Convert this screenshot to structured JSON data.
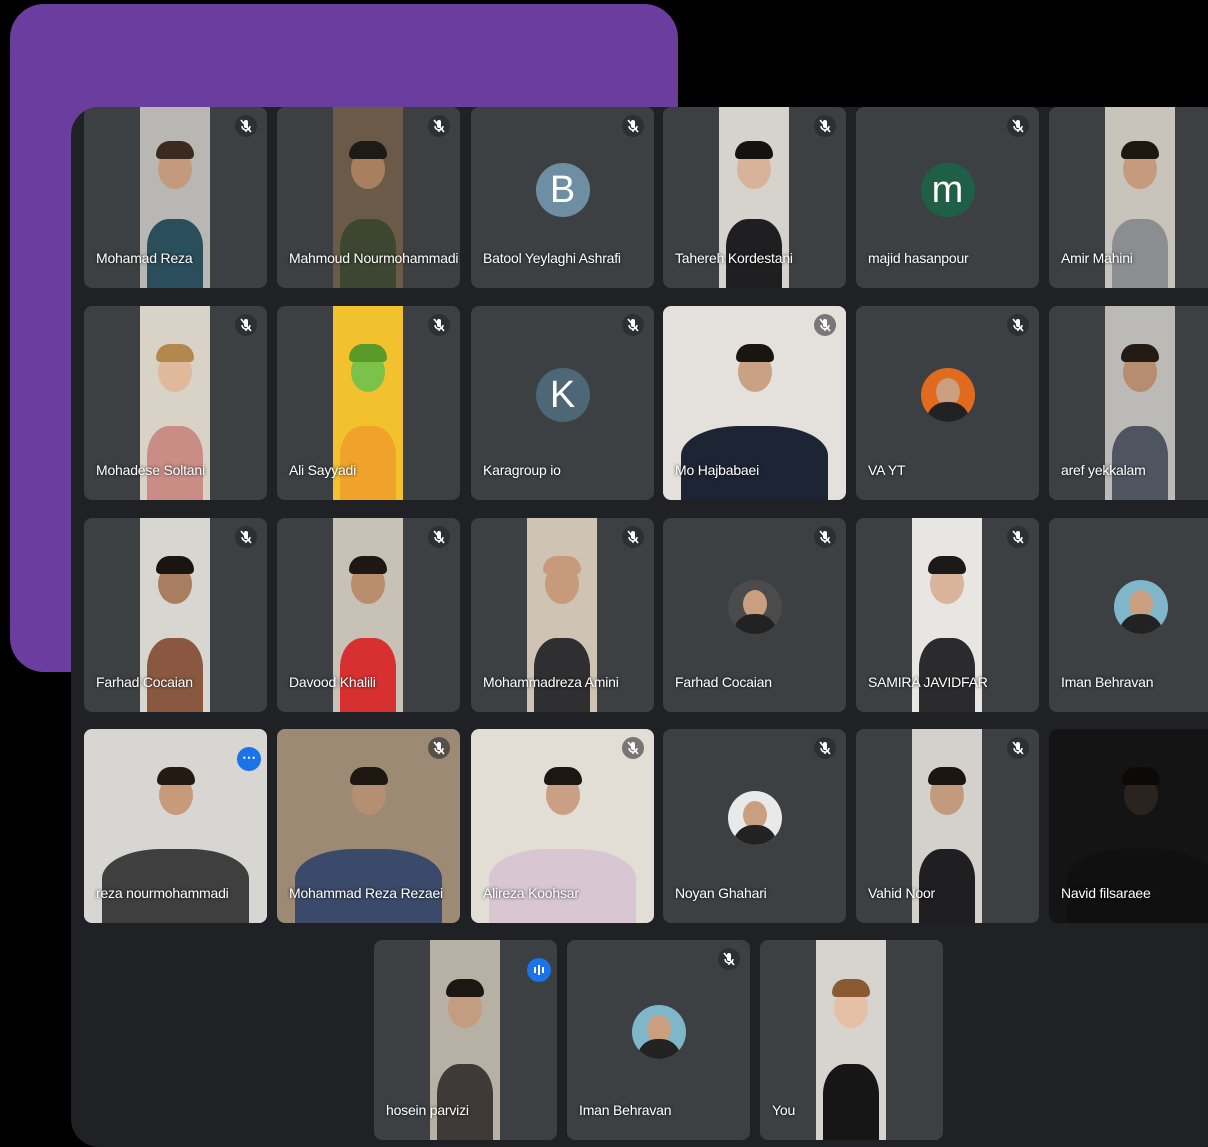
{
  "participants": [
    {
      "name": "Mohamad Reza",
      "kind": "video",
      "bg": "#b9b7b3",
      "skin": "#c49a7c",
      "hair": "#3a2a20",
      "shirt": "#2b4e5c",
      "muted": true
    },
    {
      "name": "Mahmoud Nourmohammadi",
      "kind": "video",
      "bg": "#6b5a47",
      "skin": "#a8805f",
      "hair": "#1e1a16",
      "shirt": "#3d4630",
      "muted": true
    },
    {
      "name": "Batool Yeylaghi Ashrafi",
      "kind": "letter",
      "letter": "B",
      "color": "#6e8ea4",
      "muted": true
    },
    {
      "name": "Tahereh Kordestani",
      "kind": "video",
      "bg": "#d6d2cc",
      "skin": "#d8b39a",
      "hair": "#151210",
      "shirt": "#1f1f22",
      "muted": true
    },
    {
      "name": "majid hasanpour",
      "kind": "letter",
      "letter": "m",
      "color": "#1f5f48",
      "muted": true
    },
    {
      "name": "Amir Mahini",
      "kind": "video",
      "bg": "#c8c3bb",
      "skin": "#c69a7c",
      "hair": "#1d1712",
      "shirt": "#8b8d90",
      "muted": false
    },
    {
      "name": "Mohadese Soltani",
      "kind": "video",
      "bg": "#d9d3c7",
      "skin": "#e0b89c",
      "hair": "#b3884f",
      "shirt": "#c98d86",
      "muted": true
    },
    {
      "name": "Ali Sayyadi",
      "kind": "video",
      "bg": "#f2c12e",
      "skin": "#7cc24a",
      "hair": "#5a9a2a",
      "shirt": "#f0a22a",
      "muted": true
    },
    {
      "name": "Karagroup io",
      "kind": "letter",
      "letter": "K",
      "color": "#4d6777",
      "muted": true
    },
    {
      "name": "Mo Hajbabaei",
      "kind": "video",
      "bg": "#e4e1dc",
      "skin": "#c9a283",
      "hair": "#1b1511",
      "shirt": "#1d2433",
      "muted": true
    },
    {
      "name": "VA YT",
      "kind": "photo",
      "color": "#e06a1e",
      "muted": true
    },
    {
      "name": "aref yekkalam",
      "kind": "video",
      "bg": "#bcbab6",
      "skin": "#b68d6f",
      "hair": "#241b14",
      "shirt": "#4e5560",
      "muted": false
    },
    {
      "name": "Farhad Cocaian",
      "kind": "video",
      "bg": "#d8d6d1",
      "skin": "#a97e60",
      "hair": "#1a1511",
      "shirt": "#8a5840",
      "muted": true
    },
    {
      "name": "Davood Khalili",
      "kind": "video",
      "bg": "#c7c1b6",
      "skin": "#b88e6d",
      "hair": "#1d1813",
      "shirt": "#d63031",
      "muted": true
    },
    {
      "name": "Mohammadreza Amini",
      "kind": "video",
      "bg": "#cfc3b3",
      "skin": "#c69a7a",
      "hair": "#c69a7a",
      "shirt": "#2f2f31",
      "muted": true
    },
    {
      "name": "Farhad Cocaian",
      "kind": "photo",
      "color": "#4b4b4b",
      "muted": true
    },
    {
      "name": "SAMIRA JAVIDFAR",
      "kind": "video",
      "bg": "#e8e6e2",
      "skin": "#d9b39a",
      "hair": "#1c1a19",
      "shirt": "#2b2b2d",
      "muted": true
    },
    {
      "name": "Iman Behravan",
      "kind": "photo",
      "color": "#7fb6c9",
      "muted": false
    },
    {
      "name": "reza nourmohammadi",
      "kind": "video",
      "bg": "#d7d6d3",
      "skin": "#c79b7a",
      "hair": "#241a13",
      "shirt": "#3f3f3f",
      "muted": false,
      "active": true,
      "more": true
    },
    {
      "name": "Mohammad Reza Rezaei",
      "kind": "video",
      "bg": "#9c8a74",
      "skin": "#b58f72",
      "hair": "#1d1712",
      "shirt": "#3b4a6a",
      "muted": true
    },
    {
      "name": "Alireza Koohsar",
      "kind": "video",
      "bg": "#e2ddd5",
      "skin": "#caa084",
      "hair": "#1d1712",
      "shirt": "#d8c7d3",
      "muted": true
    },
    {
      "name": "Noyan Ghahari",
      "kind": "photo",
      "color": "#e9e9e9",
      "muted": true
    },
    {
      "name": "Vahid Noor",
      "kind": "video",
      "bg": "#d4d0cb",
      "skin": "#c39a7d",
      "hair": "#1b1612",
      "shirt": "#1f1f21",
      "muted": true
    },
    {
      "name": "Navid filsaraee",
      "kind": "video",
      "bg": "#141414",
      "skin": "#2b231d",
      "hair": "#0c0a09",
      "shirt": "#101010",
      "muted": false
    },
    {
      "name": "hosein parvizi",
      "kind": "video",
      "bg": "#b7b0a5",
      "skin": "#c49c7f",
      "hair": "#1c1713",
      "shirt": "#3d3a37",
      "muted": false,
      "speaking": true
    },
    {
      "name": "Iman Behravan",
      "kind": "photo",
      "color": "#7fb6c9",
      "muted": true
    },
    {
      "name": "You",
      "kind": "video",
      "bg": "#d7d3cf",
      "skin": "#e6c0a5",
      "hair": "#8a5a33",
      "shirt": "#161616",
      "muted": false
    }
  ]
}
